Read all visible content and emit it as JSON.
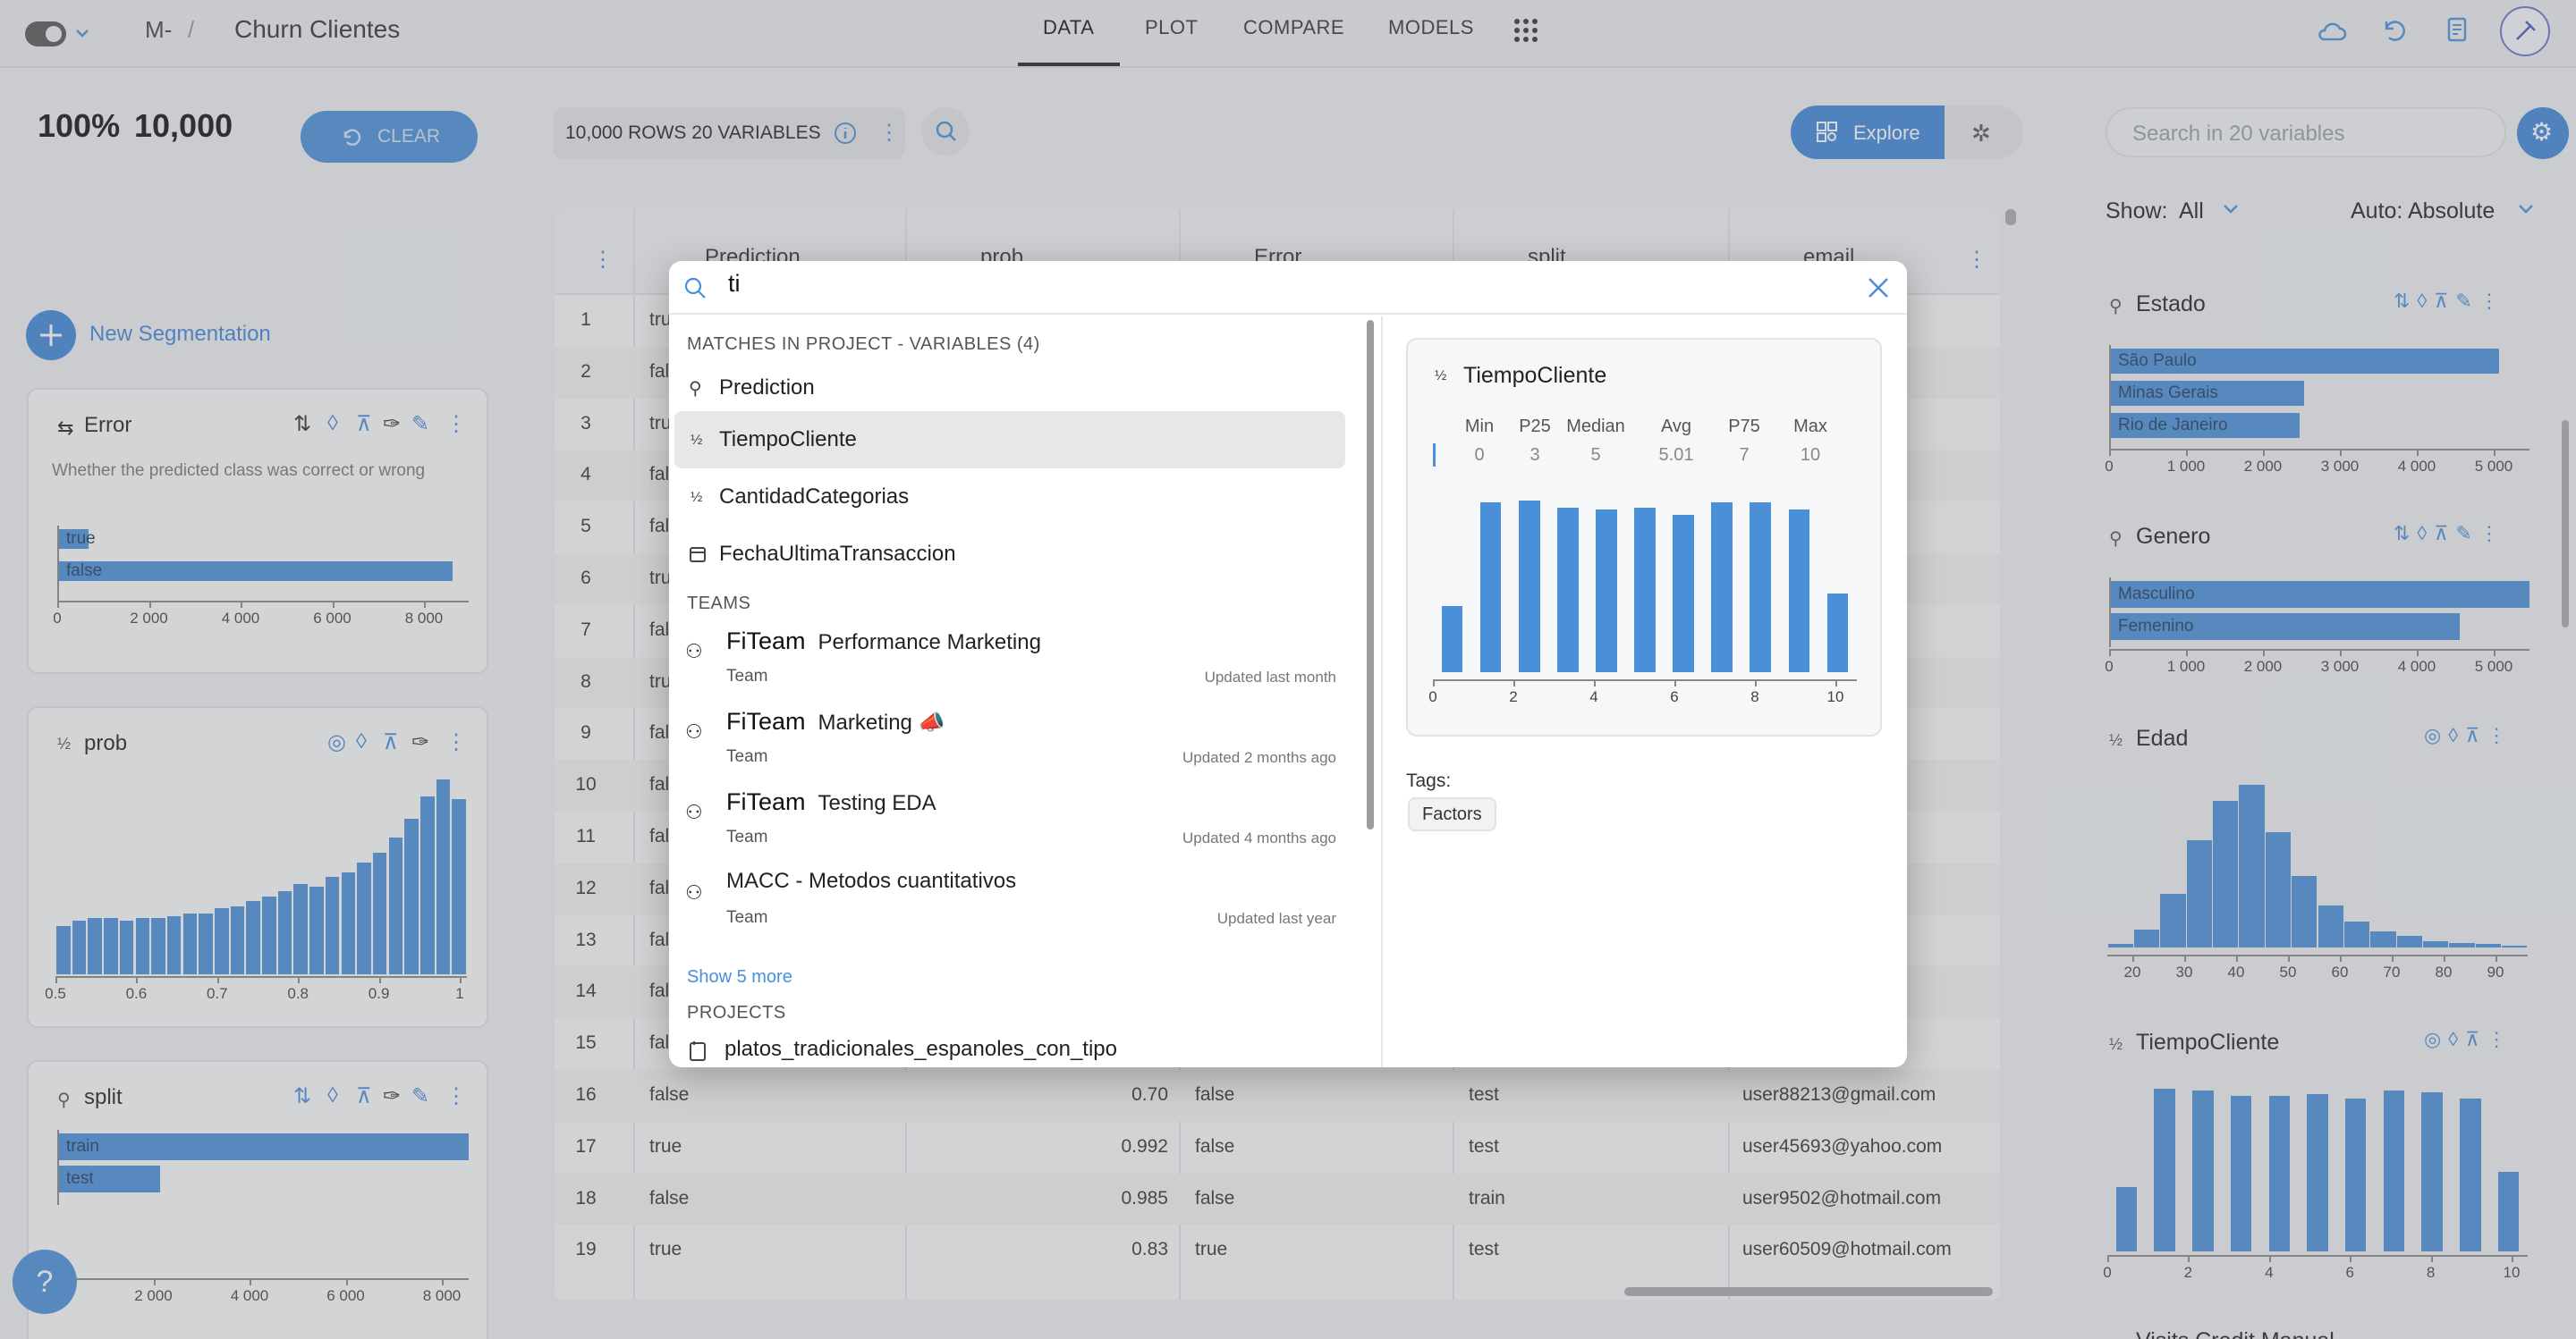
{
  "header": {
    "project_prefix": "M-",
    "separator": "/",
    "project_name": "Churn Clientes",
    "tabs": [
      {
        "label": "DATA"
      },
      {
        "label": "PLOT"
      },
      {
        "label": "COMPARE"
      },
      {
        "label": "MODELS"
      }
    ]
  },
  "left": {
    "percent": "100%",
    "count": "10,000",
    "clear_label": "CLEAR",
    "new_segmentation": "New Segmentation",
    "error_card": {
      "title": "Error",
      "description": "Whether the predicted class was correct or wrong",
      "bars": [
        {
          "label": "true",
          "value": 700
        },
        {
          "label": "false",
          "value": 8900
        }
      ],
      "ticks": [
        "0",
        "2 000",
        "4 000",
        "6 000",
        "8 000"
      ]
    },
    "prob_card": {
      "title": "prob",
      "ticks": [
        "0.5",
        "0.6",
        "0.7",
        "0.8",
        "0.9",
        "1"
      ],
      "values": [
        20,
        22,
        23,
        23,
        22,
        23,
        23,
        24,
        25,
        25,
        27,
        28,
        30,
        32,
        34,
        37,
        36,
        40,
        42,
        46,
        50,
        56,
        64,
        73,
        80,
        72
      ]
    },
    "split_card": {
      "title": "split",
      "bars": [
        {
          "label": "train",
          "value": 8000
        },
        {
          "label": "test",
          "value": 2000
        }
      ],
      "ticks": [
        "0",
        "2 000",
        "4 000",
        "6 000",
        "8 000"
      ]
    },
    "help": "?"
  },
  "toolbar": {
    "rows_vars": "10,000 ROWS 20 VARIABLES",
    "explore_label": "Explore"
  },
  "table": {
    "headers": [
      "Prediction",
      "prob",
      "Error",
      "split",
      "email"
    ],
    "rows": [
      {
        "n": "1",
        "c1": "tru",
        "email": ".com"
      },
      {
        "n": "2",
        "c1": "fal",
        "email": ".com"
      },
      {
        "n": "3",
        "c1": "tru",
        "email": ".com"
      },
      {
        "n": "4",
        "c1": "fal",
        "email": ".com"
      },
      {
        "n": "5",
        "c1": "fal",
        "email": "om"
      },
      {
        "n": "6",
        "c1": "tru",
        "email": ".com"
      },
      {
        "n": "7",
        "c1": "fal",
        "email": ".com"
      },
      {
        "n": "8",
        "c1": "tru",
        "email": "l.com"
      },
      {
        "n": "9",
        "c1": "fal",
        "email": "om"
      },
      {
        "n": "10",
        "c1": "fal",
        "email": "om"
      },
      {
        "n": "11",
        "c1": "fal",
        "email": "om"
      },
      {
        "n": "12",
        "c1": "fal",
        "email": ".com"
      },
      {
        "n": "13",
        "c1": "fal",
        "email": "l.com"
      },
      {
        "n": "14",
        "c1": "fal",
        "email": "om"
      },
      {
        "n": "15",
        "c1": "fal",
        "email": "om"
      }
    ],
    "full_rows": [
      {
        "n": "16",
        "pred": "false",
        "prob": "0.70",
        "err": "false",
        "split": "test",
        "email": "user88213@gmail.com"
      },
      {
        "n": "17",
        "pred": "true",
        "prob": "0.992",
        "err": "false",
        "split": "test",
        "email": "user45693@yahoo.com"
      },
      {
        "n": "18",
        "pred": "false",
        "prob": "0.985",
        "err": "false",
        "split": "train",
        "email": "user9502@hotmail.com"
      },
      {
        "n": "19",
        "pred": "true",
        "prob": "0.83",
        "err": "true",
        "split": "test",
        "email": "user60509@hotmail.com"
      }
    ]
  },
  "right": {
    "search_placeholder": "Search in 20 variables",
    "show_label": "Show:",
    "show_value": "All",
    "auto_label": "Auto: Absolute",
    "estado": {
      "title": "Estado",
      "bars": [
        {
          "label": "São Paulo",
          "value": 5000
        },
        {
          "label": "Minas Gerais",
          "value": 2500
        },
        {
          "label": "Rio de Janeiro",
          "value": 2450
        }
      ],
      "ticks": [
        "0",
        "1 000",
        "2 000",
        "3 000",
        "4 000",
        "5 000"
      ]
    },
    "genero": {
      "title": "Genero",
      "bars": [
        {
          "label": "Masculino",
          "value": 5450
        },
        {
          "label": "Femenino",
          "value": 4550
        }
      ],
      "ticks": [
        "0",
        "1 000",
        "2 000",
        "3 000",
        "4 000",
        "5 000"
      ]
    },
    "edad": {
      "title": "Edad",
      "ticks": [
        "20",
        "30",
        "40",
        "50",
        "60",
        "70",
        "80",
        "90"
      ],
      "values": [
        2,
        11,
        33,
        66,
        90,
        100,
        71,
        44,
        26,
        16,
        10,
        7,
        4,
        3,
        2,
        1
      ]
    },
    "tiempo": {
      "title": "TiempoCliente",
      "ticks": [
        "0",
        "2",
        "4",
        "6",
        "8",
        "10"
      ],
      "values": [
        38,
        96,
        95,
        92,
        92,
        93,
        90,
        95,
        94,
        90,
        47
      ]
    },
    "next_title": "Visits Credit Manual"
  },
  "search": {
    "query": "ti",
    "matches_header": "MATCHES IN PROJECT - VARIABLES (4)",
    "variables": [
      {
        "name": "Prediction"
      },
      {
        "name": "TiempoCliente"
      },
      {
        "name": "CantidadCategorias"
      },
      {
        "name": "FechaUltimaTransaccion"
      }
    ],
    "teams_header": "TEAMS",
    "teams": [
      {
        "org": "FiTeam",
        "name": "Performance Marketing",
        "type": "Team",
        "updated": "Updated last month"
      },
      {
        "org": "FiTeam",
        "name": "Marketing 📣",
        "type": "Team",
        "updated": "Updated 2 months ago"
      },
      {
        "org": "FiTeam",
        "name": "Testing EDA",
        "type": "Team",
        "updated": "Updated 4 months ago"
      },
      {
        "org": "",
        "name": "MACC - Metodos cuantitativos",
        "type": "Team",
        "updated": "Updated last year"
      }
    ],
    "show_more": "Show 5 more",
    "projects_header": "PROJECTS",
    "projects": [
      {
        "name": "platos_tradicionales_espanoles_con_tipo"
      }
    ],
    "preview": {
      "title": "TiempoCliente",
      "stats": [
        {
          "k": "Min",
          "v": "0"
        },
        {
          "k": "P25",
          "v": "3"
        },
        {
          "k": "Median",
          "v": "5"
        },
        {
          "k": "Avg",
          "v": "5.01"
        },
        {
          "k": "P75",
          "v": "7"
        },
        {
          "k": "Max",
          "v": "10"
        }
      ],
      "ticks": [
        "0",
        "2",
        "4",
        "6",
        "8",
        "10"
      ],
      "values": [
        38,
        97,
        98,
        94,
        93,
        94,
        90,
        97,
        97,
        93,
        45
      ],
      "tags_label": "Tags:",
      "tags": [
        "Factors"
      ]
    }
  }
}
